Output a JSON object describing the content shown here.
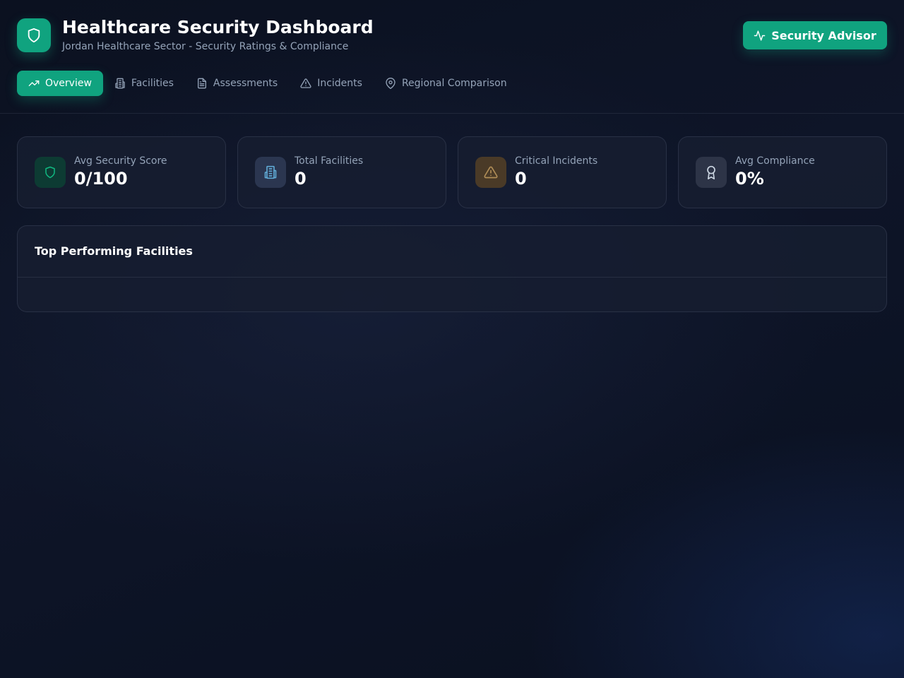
{
  "header": {
    "title": "Healthcare Security Dashboard",
    "subtitle": "Jordan Healthcare Sector - Security Ratings & Compliance",
    "logo_icon": "shield-icon",
    "advisor_button": {
      "label": "Security Advisor",
      "icon": "activity-icon"
    }
  },
  "tabs": [
    {
      "label": "Overview",
      "icon": "trending-up-icon",
      "active": true
    },
    {
      "label": "Facilities",
      "icon": "building-icon",
      "active": false
    },
    {
      "label": "Assessments",
      "icon": "file-text-icon",
      "active": false
    },
    {
      "label": "Incidents",
      "icon": "alert-triangle-icon",
      "active": false
    },
    {
      "label": "Regional Comparison",
      "icon": "map-pin-icon",
      "active": false
    }
  ],
  "stats": [
    {
      "label": "Avg Security Score",
      "value": "0/100",
      "icon": "shield-icon",
      "color": "#10b981"
    },
    {
      "label": "Total Facilities",
      "value": "0",
      "icon": "building-icon",
      "color": "#5fa8d3"
    },
    {
      "label": "Critical Incidents",
      "value": "0",
      "icon": "alert-triangle-icon",
      "color": "#b08d57"
    },
    {
      "label": "Avg Compliance",
      "value": "0%",
      "icon": "award-icon",
      "color": "#cbd5e1"
    }
  ],
  "top_facilities": {
    "title": "Top Performing Facilities",
    "items": []
  },
  "colors": {
    "accent": "#10a37f",
    "background": "#0b1120",
    "card": "#161d30",
    "muted_text": "#94a3b8"
  }
}
